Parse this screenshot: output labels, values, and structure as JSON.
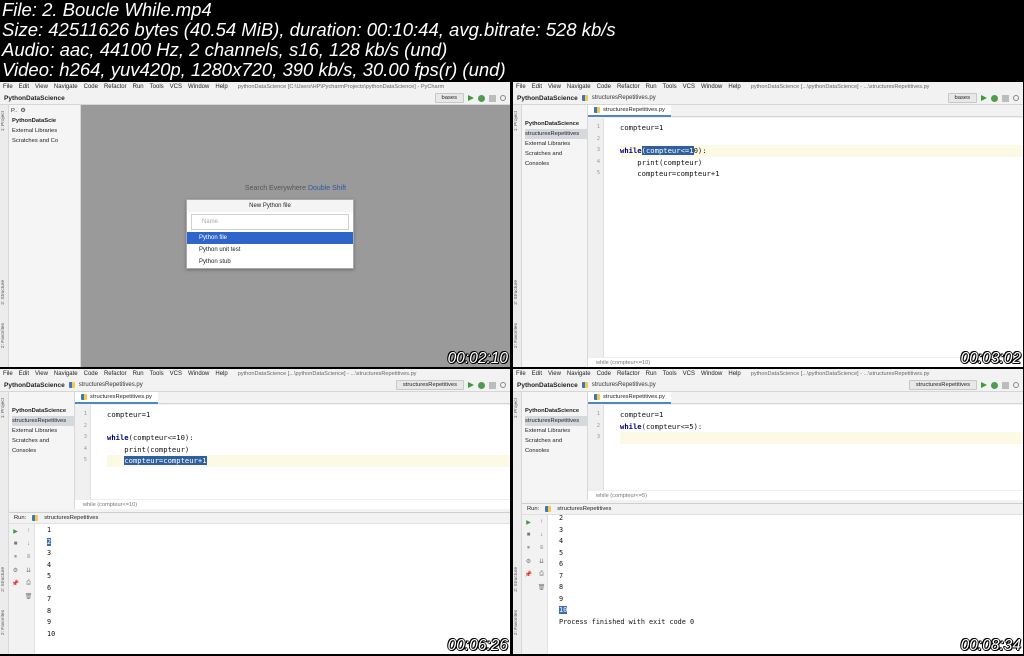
{
  "header": {
    "file_line": "File: 2. Boucle While.mp4",
    "size_line": "Size: 42511626 bytes (40.54 MiB), duration: 00:10:44, avg.bitrate: 528 kb/s",
    "audio_line": "Audio: aac, 44100 Hz, 2 channels, s16, 128 kb/s (und)",
    "video_line": "Video: h264, yuv420p, 1280x720, 390 kb/s, 30.00 fps(r) (und)"
  },
  "menu": [
    "File",
    "Edit",
    "View",
    "Navigate",
    "Code",
    "Refactor",
    "Run",
    "Tools",
    "VCS",
    "Window",
    "Help"
  ],
  "side_tabs": {
    "project": "1: Project",
    "structure": "2: Structure",
    "favorites": "2: Favorites"
  },
  "frame1": {
    "window_title": "pythonDataScience [C:\\Users\\HP\\PycharmProjects\\pythonDataScience] - PyCharm",
    "project_name": "PythonDataScience",
    "run_config": "bases",
    "pane_header": "P..",
    "tree": [
      "PythonDataScie",
      "External Libraries",
      "Scratches and Co"
    ],
    "search_hint": "Search Everywhere",
    "search_hint_key": "Double Shift",
    "popup_title": "New Python file",
    "popup_input": "Name",
    "popup_options": [
      "Python file",
      "Python unit test",
      "Python stub"
    ],
    "timestamp": "00:02:10"
  },
  "frame2": {
    "window_title": "pythonDataScience [...\\pythonDataScience] - ...\\structuresRepetitives.py",
    "project_name": "PythonDataScience",
    "crumb": "structuresRepetitives.py",
    "run_config": "bases",
    "tab": "structuresRepetitives.py",
    "tree": [
      "PythonDataScience",
      "structuresRepetitives",
      "External Libraries",
      "Scratches and Consoles"
    ],
    "line_numbers": [
      "1",
      "2",
      "3",
      "4",
      "5"
    ],
    "code": {
      "l1": "compteur=1",
      "l3_kw": "while",
      "l3_sel": "(compteur<=1",
      "l3_rest": "0):",
      "l4": "    print(compteur)",
      "l5": "    compteur=compteur+1"
    },
    "breadcrumb": "while (compteur<=10)",
    "timestamp": "00:03:02"
  },
  "frame3": {
    "window_title": "pythonDataScience [...\\pythonDataScience] - ...\\structuresRepetitives.py",
    "project_name": "PythonDataScience",
    "crumb": "structuresRepetitives.py",
    "run_config": "structuresRepetitives",
    "tab": "structuresRepetitives.py",
    "tree": [
      "PythonDataScience",
      "structuresRepetitives",
      "External Libraries",
      "Scratches and Consoles"
    ],
    "line_numbers": [
      "1",
      "2",
      "3",
      "4",
      "5"
    ],
    "code": {
      "l1": "compteur=1",
      "l3_kw": "while",
      "l3_rest": "(compteur<=10):",
      "l4": "    print(compteur)",
      "l5_indent": "    ",
      "l5_sel": "compteur=compteur+1"
    },
    "breadcrumb": "while (compteur<=10)",
    "run_label": "Run:",
    "run_tab": "structuresRepetitives",
    "output": [
      "1",
      "2",
      "3",
      "4",
      "5",
      "6",
      "7",
      "8",
      "9",
      "10"
    ],
    "timestamp": "00:06:26"
  },
  "frame4": {
    "window_title": "pythonDataScience [...\\pythonDataScience] - ...\\structuresRepetitives.py",
    "project_name": "PythonDataScience",
    "crumb": "structuresRepetitives.py",
    "run_config": "structuresRepetitives",
    "tab": "structuresRepetitives.py",
    "tree": [
      "PythonDataScience",
      "structuresRepetitives",
      "External Libraries",
      "Scratches and Consoles"
    ],
    "line_numbers": [
      "1",
      "2",
      "3"
    ],
    "code": {
      "l1": "compteur=1",
      "l2_kw": "while",
      "l2_rest": "(compteur<=5):"
    },
    "breadcrumb": "while (compteur<=5)",
    "run_label": "Run:",
    "run_tab": "structuresRepetitives",
    "output": [
      "2",
      "3",
      "4",
      "5",
      "6",
      "7",
      "8",
      "9"
    ],
    "output_last": "10",
    "exit_message": "Process finished with exit code 0",
    "timestamp": "00:08:34"
  }
}
